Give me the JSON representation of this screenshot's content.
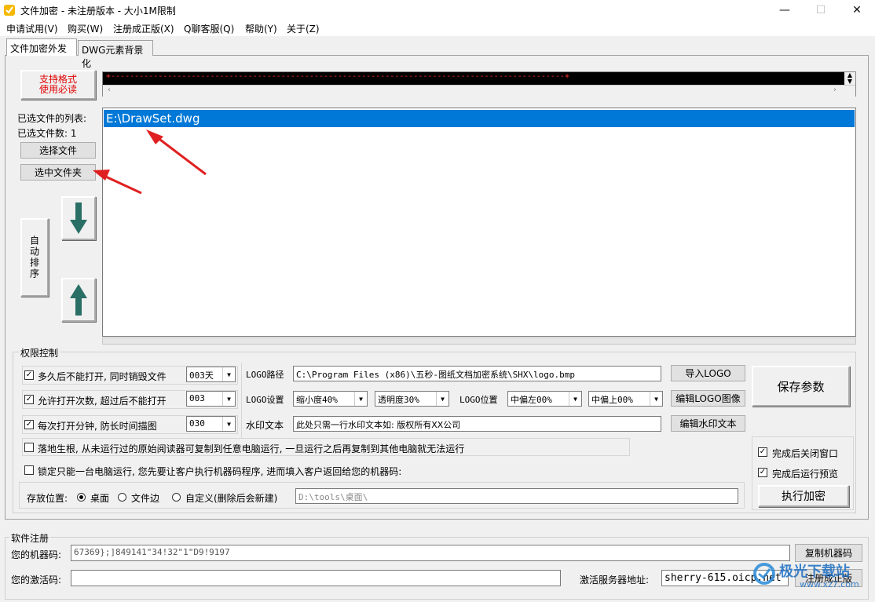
{
  "window": {
    "title": "文件加密 - 未注册版本 - 大小1M限制",
    "minimize": "—",
    "maximize": "☐",
    "close": "✕"
  },
  "menu": [
    "申请试用(V)",
    "购买(W)",
    "注册成正版(X)",
    "Q聊客服(Q)",
    "帮助(Y)",
    "关于(Z)"
  ],
  "tabs": [
    "文件加密外发",
    "DWG元素背景化"
  ],
  "formats_button": {
    "line1": "支持格式",
    "line2": "使用必读"
  },
  "marquee_text": "+------------------------------------------------------------------------------------------------+",
  "files": {
    "list_label": "已选文件的列表:",
    "count_label": "已选文件数: 1",
    "select_file": "选择文件",
    "select_folder": "选中文件夹",
    "auto_sort": "自动排序",
    "items": [
      "E:\\DrawSet.dwg"
    ]
  },
  "permissions": {
    "group_title": "权限控制",
    "rows": [
      {
        "label": "多久后不能打开, 同时销毁文件",
        "checked": true,
        "value": "003天"
      },
      {
        "label": "允许打开次数, 超过后不能打开",
        "checked": true,
        "value": "003"
      },
      {
        "label": "每次打开分钟, 防长时间描图",
        "checked": true,
        "value": "030"
      }
    ],
    "logo_path_label": "LOGO路径",
    "logo_path": "C:\\Program Files (x86)\\五秒-图纸文档加密系统\\SHX\\logo.bmp",
    "import_logo": "导入LOGO",
    "logo_settings_label": "LOGO设置",
    "scale": "缩小度40%",
    "opacity": "透明度30%",
    "logo_pos_label": "LOGO位置",
    "pos_left": "中偏左00%",
    "pos_top": "中偏上00%",
    "edit_logo": "编辑LOGO图像",
    "watermark_label": "水印文本",
    "watermark_text": "此处只需一行水印文本如: 版权所有XX公司",
    "edit_watermark": "编辑水印文本",
    "save_params": "保存参数",
    "root_option": "落地生根, 从未运行过的原始阅读器可复制到任意电脑运行, 一旦运行之后再复制到其他电脑就无法运行",
    "lock_option": "锁定只能一台电脑运行, 您先要让客户执行机器码程序, 进而填入客户返回给您的机器码:",
    "close_after": "完成后关闭窗口",
    "preview_after": "完成后运行预览",
    "run_encrypt": "执行加密",
    "save_location_label": "存放位置:",
    "loc_desktop": "桌面",
    "loc_file_side": "文件边",
    "loc_custom": "自定义(删除后会新建)",
    "custom_path": "D:\\tools\\桌面\\"
  },
  "registration": {
    "group_title": "软件注册",
    "machine_label": "您的机器码:",
    "machine_code": "67369};]849141\"34!32\"1\"D9!9197",
    "copy_machine": "复制机器码",
    "activation_label": "您的激活码:",
    "activation_code": "",
    "server_label": "激活服务器地址:",
    "server": "sherry-615.oicp.net",
    "register": "注册成正版"
  },
  "watermark_logo": {
    "text": "极光下载站",
    "url": "www.xz7.com"
  },
  "colors": {
    "selection": "#0078d7",
    "arrow": "#e02020",
    "teal_arrow": "#2a6f66",
    "red_text": "#e00000"
  }
}
